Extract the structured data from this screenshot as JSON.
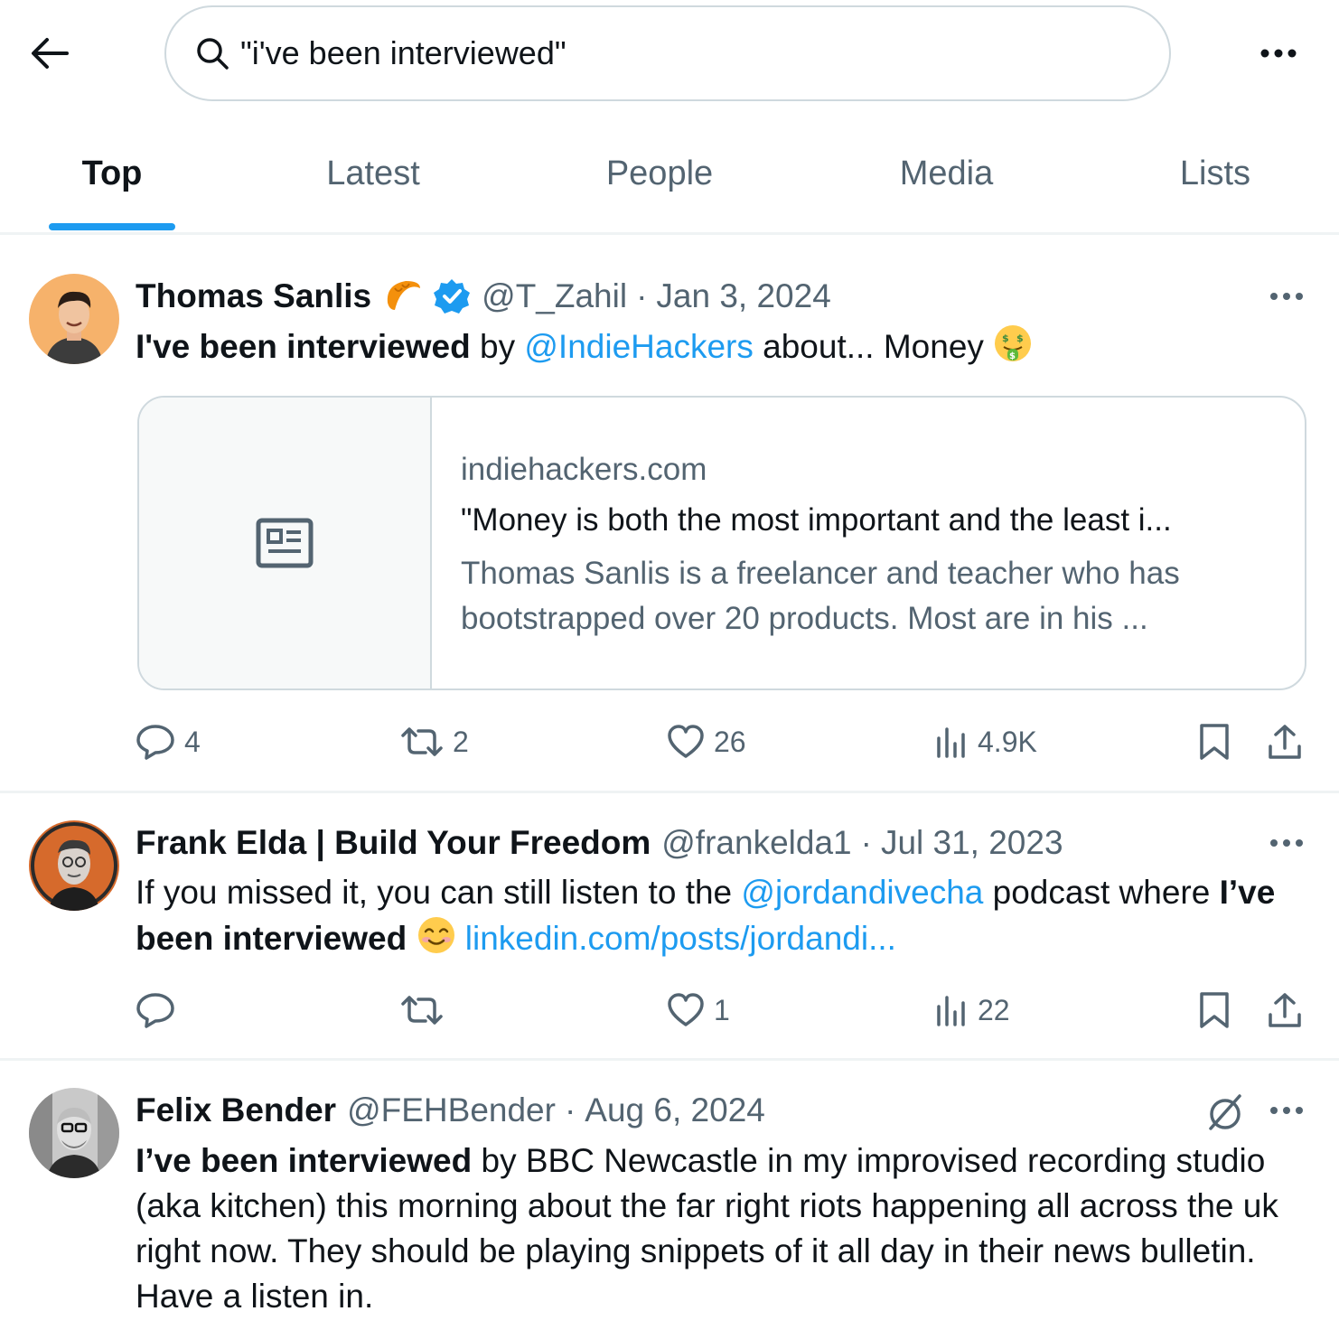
{
  "header": {
    "search_value": "\"i've been interviewed\"",
    "icons": [
      "arrow-left-icon",
      "search-icon",
      "more-icon"
    ]
  },
  "tabs": [
    {
      "label": "Top",
      "active": true
    },
    {
      "label": "Latest",
      "active": false
    },
    {
      "label": "People",
      "active": false
    },
    {
      "label": "Media",
      "active": false
    },
    {
      "label": "Lists",
      "active": false
    }
  ],
  "colors": {
    "accent": "#1d9bf0",
    "text": "#0f1419",
    "muted": "#536471",
    "border": "#cfd9de"
  },
  "tweets": [
    {
      "name": "Thomas Sanlis",
      "name_emoji": "croissant",
      "verified": true,
      "handle": "@T_Zahil",
      "date": "Jan 3, 2024",
      "text_bold": "I've been interviewed",
      "text_1": " by ",
      "mention": "@IndieHackers",
      "text_2": " about... Money ",
      "text_emoji": "money-mouth-face",
      "card": {
        "domain": "indiehackers.com",
        "title": "\"Money is both the most important and the least i...",
        "description": "Thomas Sanlis is a freelancer and teacher who has bootstrapped over 20 products. Most are in his ..."
      },
      "replies": "4",
      "reposts": "2",
      "likes": "26",
      "views": "4.9K"
    },
    {
      "name": "Frank Elda | Build Your Freedom",
      "handle": "@frankelda1",
      "date": "Jul 31, 2023",
      "text_1": "If you missed it, you can still listen to the ",
      "mention": "@jordandivecha",
      "text_2": " podcast where ",
      "text_bold": "I’ve been interviewed",
      "text_emoji": "smiling-face-with-smiling-eyes",
      "url": "linkedin.com/posts/jordandi...",
      "replies": "",
      "reposts": "",
      "likes": "1",
      "views": "22"
    },
    {
      "name": "Felix Bender",
      "handle": "@FEHBender",
      "date": "Aug 6, 2024",
      "text_bold": "I’ve been interviewed",
      "text_1": " by BBC Newcastle in my improvised recording studio (aka kitchen) this morning about the far right riots happening all across the uk right now. They should be playing snippets of it all day in their news bulletin. Have a listen in."
    }
  ]
}
